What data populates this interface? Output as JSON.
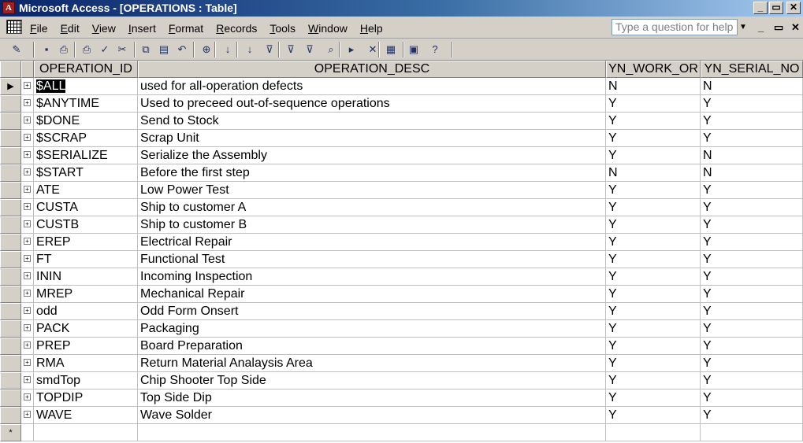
{
  "window": {
    "title": "Microsoft Access - [OPERATIONS : Table]",
    "app_icon": "access-key-icon",
    "buttons": [
      "_",
      "▭",
      "✕"
    ]
  },
  "menubar": {
    "items": [
      {
        "label": "File"
      },
      {
        "label": "Edit"
      },
      {
        "label": "View"
      },
      {
        "label": "Insert"
      },
      {
        "label": "Format"
      },
      {
        "label": "Records"
      },
      {
        "label": "Tools"
      },
      {
        "label": "Window"
      },
      {
        "label": "Help"
      }
    ],
    "help_placeholder": "Type a question for help",
    "mdi_buttons": [
      "_",
      "▭",
      "✕"
    ]
  },
  "toolbar": {
    "icons": [
      "design-view-icon",
      "save-icon",
      "print-preview-icon",
      "print-icon",
      "spelling-icon",
      "cut-icon",
      "copy-icon",
      "paste-icon",
      "undo-icon",
      "insert-hyperlink-icon",
      "sort-ascending-icon",
      "sort-descending-icon",
      "filter-by-selection-icon",
      "filter-by-form-icon",
      "apply-filter-icon",
      "find-icon",
      "new-record-icon",
      "delete-record-icon",
      "database-window-icon",
      "new-object-icon",
      "help-icon"
    ]
  },
  "table": {
    "columns": [
      "OPERATION_ID",
      "OPERATION_DESC",
      "YN_WORK_OR",
      "YN_SERIAL_NO"
    ],
    "rows": [
      {
        "id": "$ALL",
        "desc": "used for all-operation defects",
        "work": "N",
        "serial": "N"
      },
      {
        "id": "$ANYTIME",
        "desc": "Used to preceed out-of-sequence operations",
        "work": "Y",
        "serial": "Y"
      },
      {
        "id": "$DONE",
        "desc": "Send to Stock",
        "work": "Y",
        "serial": "Y"
      },
      {
        "id": "$SCRAP",
        "desc": "Scrap Unit",
        "work": "Y",
        "serial": "Y"
      },
      {
        "id": "$SERIALIZE",
        "desc": "Serialize the Assembly",
        "work": "Y",
        "serial": "N"
      },
      {
        "id": "$START",
        "desc": "Before the first step",
        "work": "N",
        "serial": "N"
      },
      {
        "id": "ATE",
        "desc": "Low Power Test",
        "work": "Y",
        "serial": "Y"
      },
      {
        "id": "CUSTA",
        "desc": "Ship to customer A",
        "work": "Y",
        "serial": "Y"
      },
      {
        "id": "CUSTB",
        "desc": "Ship to customer B",
        "work": "Y",
        "serial": "Y"
      },
      {
        "id": "EREP",
        "desc": "Electrical Repair",
        "work": "Y",
        "serial": "Y"
      },
      {
        "id": "FT",
        "desc": "Functional Test",
        "work": "Y",
        "serial": "Y"
      },
      {
        "id": "ININ",
        "desc": "Incoming Inspection",
        "work": "Y",
        "serial": "Y"
      },
      {
        "id": "MREP",
        "desc": "Mechanical Repair",
        "work": "Y",
        "serial": "Y"
      },
      {
        "id": "odd",
        "desc": "Odd Form Onsert",
        "work": "Y",
        "serial": "Y"
      },
      {
        "id": "PACK",
        "desc": "Packaging",
        "work": "Y",
        "serial": "Y"
      },
      {
        "id": "PREP",
        "desc": "Board Preparation",
        "work": "Y",
        "serial": "Y"
      },
      {
        "id": "RMA",
        "desc": "Return Material Analaysis Area",
        "work": "Y",
        "serial": "Y"
      },
      {
        "id": "smdTop",
        "desc": "Chip Shooter Top Side",
        "work": "Y",
        "serial": "Y"
      },
      {
        "id": "TOPDIP",
        "desc": "Top Side Dip",
        "work": "Y",
        "serial": "Y"
      },
      {
        "id": "WAVE",
        "desc": "Wave Solder",
        "work": "Y",
        "serial": "Y"
      }
    ],
    "current_row_marker": "▶",
    "new_row_marker": "*",
    "expander_glyph": "+"
  }
}
